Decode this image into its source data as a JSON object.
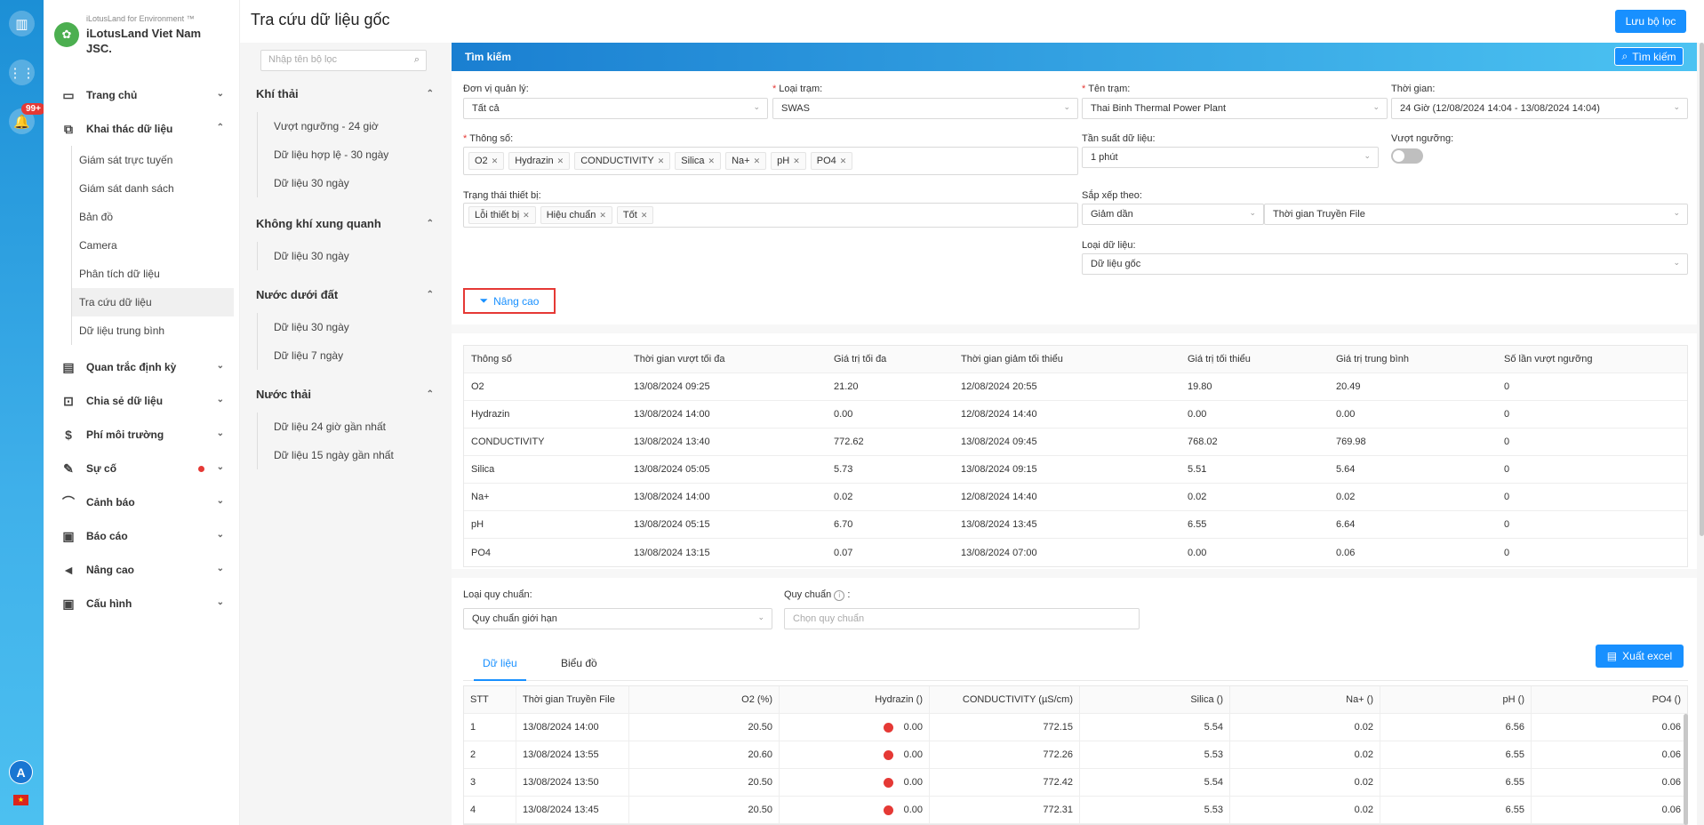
{
  "rail": {
    "badge": "99+",
    "avatar": "A",
    "flag": "★"
  },
  "brand": {
    "sub": "iLotusLand for Environment ™",
    "name": "iLotusLand Viet Nam JSC."
  },
  "menu": [
    {
      "label": "Trang chủ",
      "icon": "home-icon"
    },
    {
      "label": "Khai thác dữ liệu",
      "icon": "data-mining-icon",
      "expanded": true,
      "children": [
        "Giám sát trực tuyến",
        "Giám sát danh sách",
        "Bản đồ",
        "Camera",
        "Phân tích dữ liệu",
        "Tra cứu dữ liệu",
        "Dữ liệu trung bình"
      ]
    },
    {
      "label": "Quan trắc định kỳ",
      "icon": "periodic-icon"
    },
    {
      "label": "Chia sẻ dữ liệu",
      "icon": "share-icon"
    },
    {
      "label": "Phí môi trường",
      "icon": "fee-icon"
    },
    {
      "label": "Sự cố",
      "icon": "incident-icon"
    },
    {
      "label": "Cảnh báo",
      "icon": "alarm-icon"
    },
    {
      "label": "Báo cáo",
      "icon": "report-icon"
    },
    {
      "label": "Nâng cao",
      "icon": "megaphone-icon"
    },
    {
      "label": "Cấu hình",
      "icon": "config-icon"
    }
  ],
  "page": {
    "title": "Tra cứu dữ liệu gốc",
    "save_filter": "Lưu bộ lọc"
  },
  "filters": {
    "placeholder": "Nhập tên bộ lọc",
    "groups": [
      {
        "title": "Khí thải",
        "items": [
          "Vượt ngưỡng - 24 giờ",
          "Dữ liệu hợp lệ - 30 ngày",
          "Dữ liệu 30 ngày"
        ]
      },
      {
        "title": "Không khí xung quanh",
        "items": [
          "Dữ liệu 30 ngày"
        ]
      },
      {
        "title": "Nước dưới đất",
        "items": [
          "Dữ liệu 30 ngày",
          "Dữ liệu 7 ngày"
        ]
      },
      {
        "title": "Nước thải",
        "items": [
          "Dữ liệu 24 giờ gần nhất",
          "Dữ liệu 15 ngày gần nhất"
        ]
      }
    ]
  },
  "search": {
    "header": "Tìm kiếm",
    "button": "Tìm kiếm",
    "unit_label": "Đơn vị quản lý:",
    "unit_value": "Tất cả",
    "type_label": "Loại trạm:",
    "type_value": "SWAS",
    "station_label": "Tên trạm:",
    "station_value": "Thai Binh Thermal Power Plant",
    "time_label": "Thời gian:",
    "time_value": "24 Giờ (12/08/2024 14:04 - 13/08/2024 14:04)",
    "param_label": "Thông số:",
    "params": [
      "O2",
      "Hydrazin",
      "CONDUCTIVITY",
      "Silica",
      "Na+",
      "pH",
      "PO4"
    ],
    "freq_label": "Tần suất dữ liệu:",
    "freq_value": "1 phút",
    "exceed_label": "Vượt ngưỡng:",
    "device_label": "Trạng thái thiết bị:",
    "devices": [
      "Lỗi thiết bị",
      "Hiệu chuẩn",
      "Tốt"
    ],
    "sort_label": "Sắp xếp theo:",
    "sort_order": "Giảm dần",
    "sort_field": "Thời gian Truyền File",
    "datatype_label": "Loại dữ liệu:",
    "datatype_value": "Dữ liệu gốc",
    "advanced": "Nâng cao"
  },
  "summary": {
    "headers": [
      "Thông số",
      "Thời gian vượt tối đa",
      "Giá trị tối đa",
      "Thời gian giảm tối thiểu",
      "Giá trị tối thiểu",
      "Giá trị trung bình",
      "Số lần vượt ngưỡng"
    ],
    "rows": [
      [
        "O2",
        "13/08/2024 09:25",
        "21.20",
        "12/08/2024 20:55",
        "19.80",
        "20.49",
        "0"
      ],
      [
        "Hydrazin",
        "13/08/2024 14:00",
        "0.00",
        "12/08/2024 14:40",
        "0.00",
        "0.00",
        "0"
      ],
      [
        "CONDUCTIVITY",
        "13/08/2024 13:40",
        "772.62",
        "13/08/2024 09:45",
        "768.02",
        "769.98",
        "0"
      ],
      [
        "Silica",
        "13/08/2024 05:05",
        "5.73",
        "13/08/2024 09:15",
        "5.51",
        "5.64",
        "0"
      ],
      [
        "Na+",
        "13/08/2024 14:00",
        "0.02",
        "12/08/2024 14:40",
        "0.02",
        "0.02",
        "0"
      ],
      [
        "pH",
        "13/08/2024 05:15",
        "6.70",
        "13/08/2024 13:45",
        "6.55",
        "6.64",
        "0"
      ],
      [
        "PO4",
        "13/08/2024 13:15",
        "0.07",
        "13/08/2024 07:00",
        "0.00",
        "0.06",
        "0"
      ]
    ]
  },
  "standard": {
    "type_label": "Loại quy chuẩn:",
    "type_value": "Quy chuẩn giới hạn",
    "std_label": "Quy chuẩn",
    "std_placeholder": "Chọn quy chuẩn"
  },
  "tabs": {
    "data": "Dữ liệu",
    "chart": "Biểu đồ",
    "export": "Xuất excel"
  },
  "data_table": {
    "headers": [
      "STT",
      "Thời gian Truyền File",
      "O2 (%)",
      "Hydrazin ()",
      "CONDUCTIVITY (µS/cm)",
      "Silica ()",
      "Na+ ()",
      "pH ()",
      "PO4 ()"
    ],
    "rows": [
      [
        "1",
        "13/08/2024 14:00",
        "20.50",
        "0.00",
        "772.15",
        "5.54",
        "0.02",
        "6.56",
        "0.06"
      ],
      [
        "2",
        "13/08/2024 13:55",
        "20.60",
        "0.00",
        "772.26",
        "5.53",
        "0.02",
        "6.55",
        "0.06"
      ],
      [
        "3",
        "13/08/2024 13:50",
        "20.50",
        "0.00",
        "772.42",
        "5.54",
        "0.02",
        "6.55",
        "0.06"
      ],
      [
        "4",
        "13/08/2024 13:45",
        "20.50",
        "0.00",
        "772.31",
        "5.53",
        "0.02",
        "6.55",
        "0.06"
      ]
    ]
  }
}
